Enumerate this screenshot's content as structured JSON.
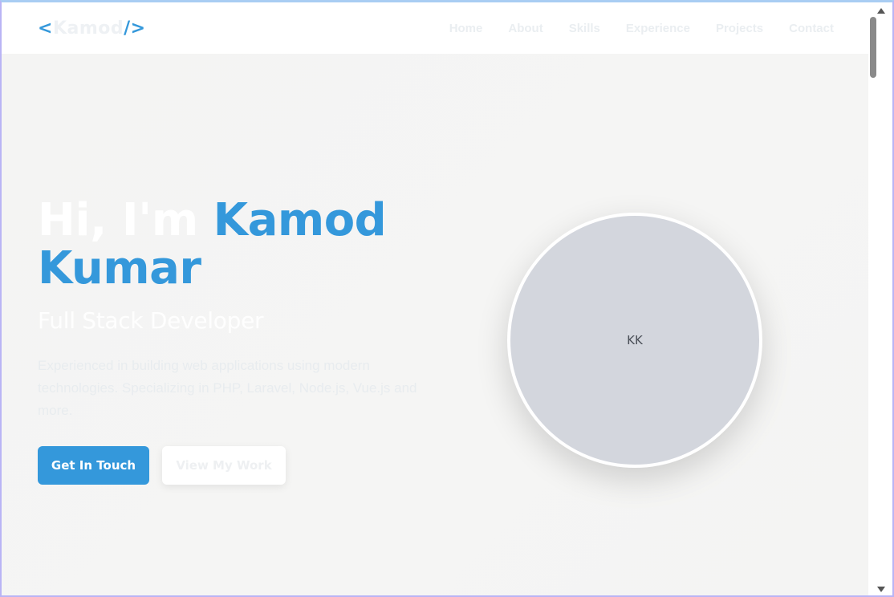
{
  "nav": {
    "logo_open": "<",
    "logo_name": "Kamod",
    "logo_close": "/>",
    "links": [
      "Home",
      "About",
      "Skills",
      "Experience",
      "Projects",
      "Contact"
    ]
  },
  "hero": {
    "title_prefix": "Hi, I'm ",
    "title_name_1": "Kamod",
    "title_name_2": "Kumar",
    "subtitle": "Full Stack Developer",
    "description": "Experienced in building web applications using modern technologies. Specializing in PHP, Laravel, Node.js, Vue.js and more.",
    "primary_button": "Get In Touch",
    "secondary_button": "View My Work"
  },
  "avatar": {
    "initials": "KK"
  },
  "colors": {
    "accent": "#3498db",
    "background": "#f4f4f3",
    "avatar_bg": "#d3d6dd"
  },
  "icons": {
    "scroll_up": "triangle-up-icon",
    "scroll_down": "triangle-down-icon"
  }
}
